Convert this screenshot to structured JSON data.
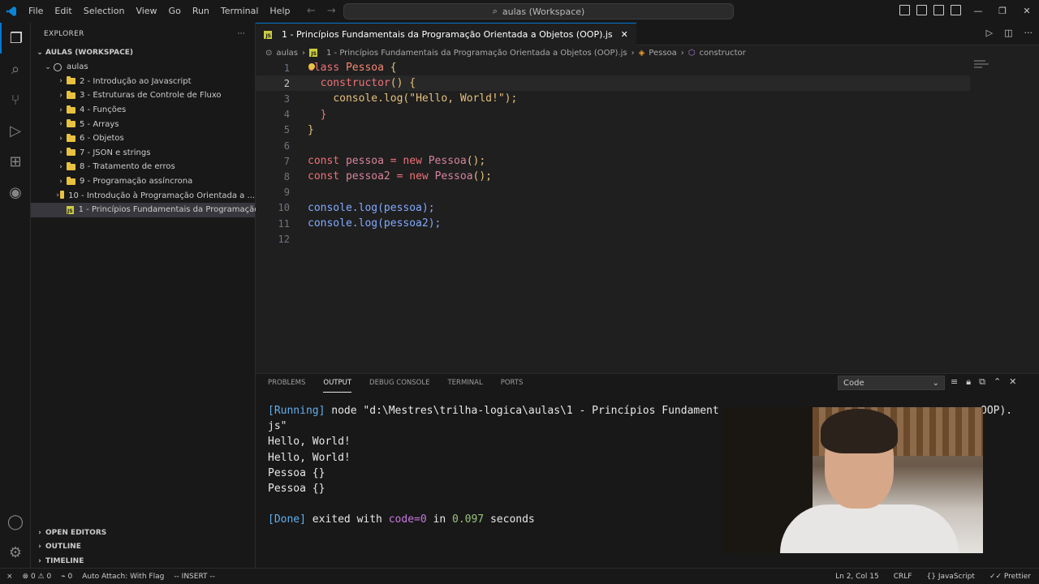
{
  "menu": [
    "File",
    "Edit",
    "Selection",
    "View",
    "Go",
    "Run",
    "Terminal",
    "Help"
  ],
  "command_center": "aulas (Workspace)",
  "explorer": {
    "title": "EXPLORER",
    "workspace": "AULAS (WORKSPACE)",
    "root": "aulas",
    "folders": [
      "2 - Introdução ao Javascript",
      "3 - Estruturas de Controle de Fluxo",
      "4 - Funções",
      "5 - Arrays",
      "6 - Objetos",
      "7 - JSON e strings",
      "8 - Tratamento de erros",
      "9 - Programação assíncrona",
      "10 - Introdução à Programação Orientada a ..."
    ],
    "selected_file": "1 - Princípios Fundamentais da Programação...",
    "sections": [
      "OPEN EDITORS",
      "OUTLINE",
      "TIMELINE"
    ]
  },
  "tab": {
    "label": "1 - Princípios Fundamentais da Programação Orientada a Objetos (OOP).js"
  },
  "breadcrumb": [
    "aulas",
    "1 - Princípios Fundamentais da Programação Orientada a Objetos (OOP).js",
    "Pessoa",
    "constructor"
  ],
  "editor": {
    "lines": [
      {
        "n": "1"
      },
      {
        "n": "2"
      },
      {
        "n": "3"
      },
      {
        "n": "4"
      },
      {
        "n": "5"
      },
      {
        "n": "6"
      },
      {
        "n": "7"
      },
      {
        "n": "8"
      },
      {
        "n": "9"
      },
      {
        "n": "10"
      },
      {
        "n": "11"
      },
      {
        "n": "12"
      }
    ],
    "code": {
      "l1_kw": "class",
      "l1_name": "Pessoa",
      "l1_rest": " {",
      "l2_fn": "constructor",
      "l2_rest": "() {",
      "l3_obj": "console",
      "l3_method": ".log(",
      "l3_str": "\"Hello, World!\"",
      "l3_end": ");",
      "l4": "}",
      "l5": "}",
      "l7_kw": "const",
      "l7_var": "pessoa",
      "l7_eq": " = ",
      "l7_new": "new",
      "l7_cls": "Pessoa",
      "l7_end": "();",
      "l8_kw": "const",
      "l8_var": "pessoa2",
      "l8_eq": " = ",
      "l8_new": "new",
      "l8_cls": "Pessoa",
      "l8_end": "();",
      "l10": "console.log(pessoa);",
      "l11": "console.log(pessoa2);"
    }
  },
  "panel": {
    "tabs": [
      "PROBLEMS",
      "OUTPUT",
      "DEBUG CONSOLE",
      "TERMINAL",
      "PORTS"
    ],
    "active_tab": "OUTPUT",
    "select_value": "Code",
    "output": {
      "running_tag": "[Running]",
      "running_cmd": " node \"d:\\Mestres\\trilha-logica\\aulas\\1 - Princípios Fundament",
      "running_tail": "OOP).",
      "running_cont": "js\"",
      "line1": "Hello, World!",
      "line2": "Hello, World!",
      "line3": "Pessoa {}",
      "line4": "Pessoa {}",
      "done_tag": "[Done]",
      "done_text": " exited with ",
      "done_code": "code=0",
      "done_in": " in ",
      "done_time": "0.097",
      "done_seconds": " seconds"
    }
  },
  "status": {
    "errors": "0",
    "warnings": "0",
    "ports": "0",
    "auto_attach": "Auto Attach: With Flag",
    "mode": "-- INSERT --",
    "position": "Ln 2, Col 15",
    "eol": "CRLF",
    "language": "JavaScript",
    "formatter": "Prettier"
  }
}
